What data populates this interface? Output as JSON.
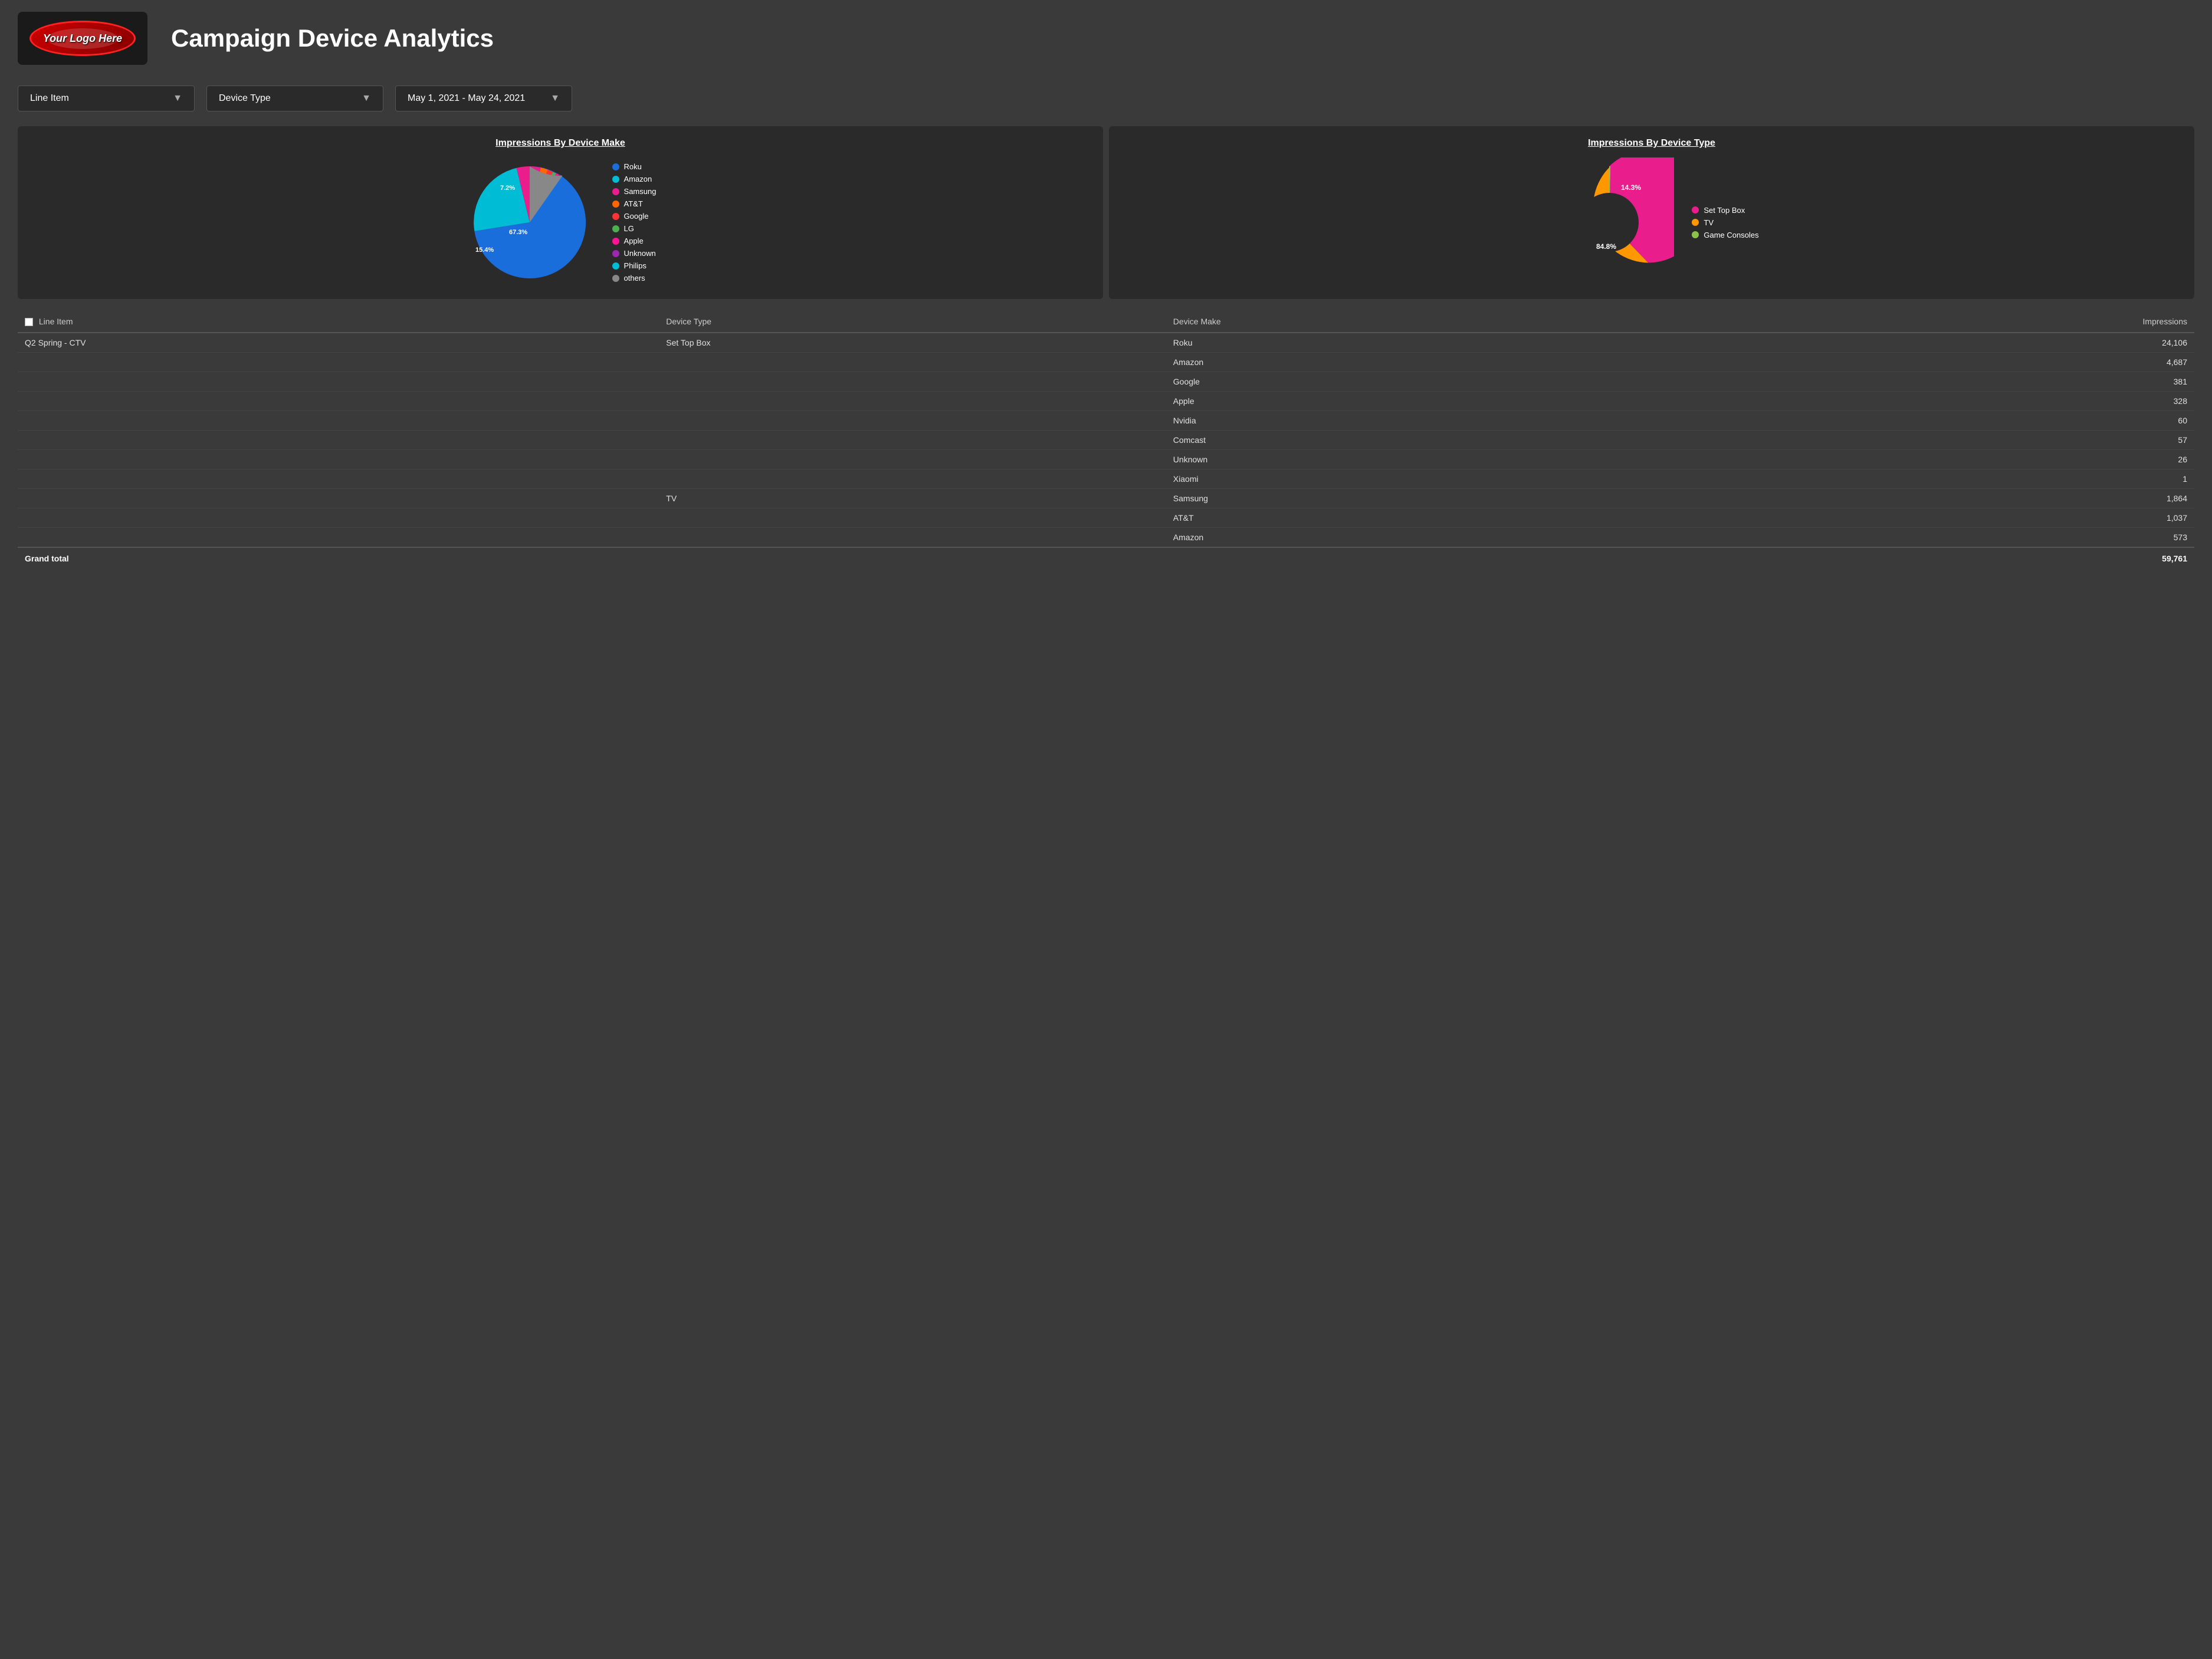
{
  "header": {
    "logo_text": "Your Logo Here",
    "page_title": "Campaign Device Analytics"
  },
  "filters": {
    "line_item_label": "Line Item",
    "device_type_label": "Device Type",
    "date_range_label": "May 1, 2021 - May 24, 2021"
  },
  "chart1": {
    "title": "Impressions By Device Make",
    "labels": {
      "roku_pct": "67.3%",
      "amazon_pct": "15.4%",
      "samsung_pct": "7.2%"
    },
    "legend": [
      {
        "label": "Roku",
        "color": "#1a6edb"
      },
      {
        "label": "Amazon",
        "color": "#00bcd4"
      },
      {
        "label": "Samsung",
        "color": "#e91e8c"
      },
      {
        "label": "AT&T",
        "color": "#ff6600"
      },
      {
        "label": "Google",
        "color": "#ff3333"
      },
      {
        "label": "LG",
        "color": "#4caf50"
      },
      {
        "label": "Apple",
        "color": "#ff1493"
      },
      {
        "label": "Unknown",
        "color": "#9c27b0"
      },
      {
        "label": "Philips",
        "color": "#00bcd4"
      },
      {
        "label": "others",
        "color": "#888888"
      }
    ]
  },
  "chart2": {
    "title": "Impressions By Device Type",
    "labels": {
      "stb_pct": "84.8%",
      "tv_pct": "14.3%"
    },
    "legend": [
      {
        "label": "Set Top Box",
        "color": "#e91e8c"
      },
      {
        "label": "TV",
        "color": "#ff9800"
      },
      {
        "label": "Game Consoles",
        "color": "#8bc34a"
      }
    ]
  },
  "table": {
    "headers": [
      "Line Item",
      "Device Type",
      "Device Make",
      "Impressions"
    ],
    "rows": [
      {
        "line_item": "Q2 Spring - CTV",
        "device_type": "Set Top Box",
        "device_make": "Roku",
        "impressions": "24,106"
      },
      {
        "line_item": "",
        "device_type": "",
        "device_make": "Amazon",
        "impressions": "4,687"
      },
      {
        "line_item": "",
        "device_type": "",
        "device_make": "Google",
        "impressions": "381"
      },
      {
        "line_item": "",
        "device_type": "",
        "device_make": "Apple",
        "impressions": "328"
      },
      {
        "line_item": "",
        "device_type": "",
        "device_make": "Nvidia",
        "impressions": "60"
      },
      {
        "line_item": "",
        "device_type": "",
        "device_make": "Comcast",
        "impressions": "57"
      },
      {
        "line_item": "",
        "device_type": "",
        "device_make": "Unknown",
        "impressions": "26"
      },
      {
        "line_item": "",
        "device_type": "",
        "device_make": "Xiaomi",
        "impressions": "1"
      },
      {
        "line_item": "",
        "device_type": "TV",
        "device_make": "Samsung",
        "impressions": "1,864"
      },
      {
        "line_item": "",
        "device_type": "",
        "device_make": "AT&T",
        "impressions": "1,037"
      },
      {
        "line_item": "",
        "device_type": "",
        "device_make": "Amazon",
        "impressions": "573"
      }
    ],
    "footer": {
      "label": "Grand total",
      "value": "59,761"
    }
  }
}
